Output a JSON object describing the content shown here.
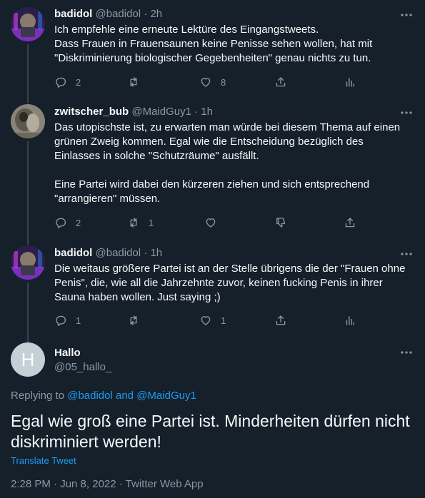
{
  "tweets": [
    {
      "name": "badidol",
      "handle": "@badidol",
      "time": "2h",
      "text": "Ich empfehle eine erneute Lektüre des Eingangstweets.\nDass Frauen in Frauensaunen keine Penisse sehen wollen, hat mit \"Diskriminierung biologischer Gegebenheiten\" genau nichts zu tun.",
      "replies": "2",
      "retweets": "",
      "likes": "8"
    },
    {
      "name": "zwitscher_bub",
      "handle": "@MaidGuy1",
      "time": "1h",
      "text": "Das utopischste ist, zu erwarten man würde bei diesem Thema auf einen grünen Zweig kommen. Egal wie die Entscheidung bezüglich des Einlasses in solche \"Schutzräume\" ausfällt.\n\nEine Partei wird dabei den kürzeren ziehen und sich entsprechend \"arrangieren\" müssen.",
      "replies": "2",
      "retweets": "1",
      "likes": ""
    },
    {
      "name": "badidol",
      "handle": "@badidol",
      "time": "1h",
      "text": "Die weitaus größere Partei ist an der Stelle übrigens die der \"Frauen ohne Penis\", die, wie all die Jahrzehnte zuvor, keinen fucking Penis in ihrer Sauna haben wollen. Just saying ;)",
      "replies": "1",
      "retweets": "",
      "likes": "1"
    }
  ],
  "main": {
    "avatar_letter": "H",
    "name": "Hallo",
    "handle": "@05_hallo_",
    "replying_prefix": "Replying to",
    "replying_user1": "@badidol",
    "replying_and": "and",
    "replying_user2": "@MaidGuy1",
    "text": "Egal wie groß eine Partei ist. Minderheiten dürfen nicht diskriminiert werden!",
    "translate": "Translate Tweet",
    "timestamp": "2:28 PM · Jun 8, 2022 · Twitter Web App"
  },
  "colors": {
    "background": "#15202b",
    "text": "#f7f9f9",
    "secondary": "#8b98a5",
    "link": "#1d9bf0",
    "thread_line": "#38444d"
  }
}
